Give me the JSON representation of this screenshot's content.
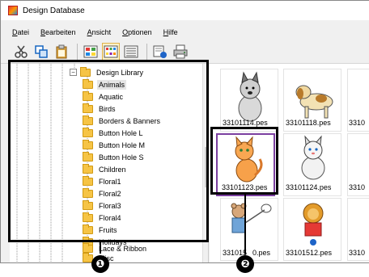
{
  "window": {
    "title": "Design Database"
  },
  "menu": [
    {
      "key": "D",
      "rest": "atei"
    },
    {
      "key": "B",
      "rest": "earbeiten"
    },
    {
      "key": "A",
      "rest": "nsicht"
    },
    {
      "key": "O",
      "rest": "ptionen"
    },
    {
      "key": "H",
      "rest": "ilfe"
    }
  ],
  "toolbar": [
    {
      "icon": "scissors-icon"
    },
    {
      "icon": "copy-icon"
    },
    {
      "icon": "paste-icon"
    },
    {
      "icon": "large-thumbnails-icon"
    },
    {
      "icon": "medium-thumbnails-icon",
      "active": true
    },
    {
      "icon": "list-view-icon"
    },
    {
      "icon": "properties-icon"
    },
    {
      "icon": "print-preview-icon"
    }
  ],
  "tree": {
    "root": "Design Library",
    "items": [
      "Animals",
      "Aquatic",
      "Birds",
      "Borders & Banners",
      "Button Hole L",
      "Button Hole M",
      "Button Hole S",
      "Children",
      "Floral1",
      "Floral2",
      "Floral3",
      "Floral4",
      "Fruits",
      "Holidays",
      "Lace & Ribbon",
      "Misc"
    ],
    "selected": "Animals"
  },
  "thumbnails": [
    {
      "file": "33101114.pes",
      "art": "husky-dog"
    },
    {
      "file": "33101118.pes",
      "art": "beagle-dog"
    },
    {
      "file": "3310",
      "art": "partial"
    },
    {
      "file": "33101123.pes",
      "art": "orange-cat",
      "selected": true
    },
    {
      "file": "33101124.pes",
      "art": "white-cat"
    },
    {
      "file": "3310",
      "art": "partial"
    },
    {
      "file": "331015",
      "art": "bear-net"
    },
    {
      "file": "0.pes",
      "art": ""
    },
    {
      "file": "33101512.pes",
      "art": "lion-bear"
    },
    {
      "file": "3310",
      "art": "partial"
    }
  ],
  "callouts": [
    "❶",
    "❷"
  ],
  "colors": {
    "callout": "#000000",
    "selection": "#7b3fa0",
    "folder": "#f6c445"
  }
}
